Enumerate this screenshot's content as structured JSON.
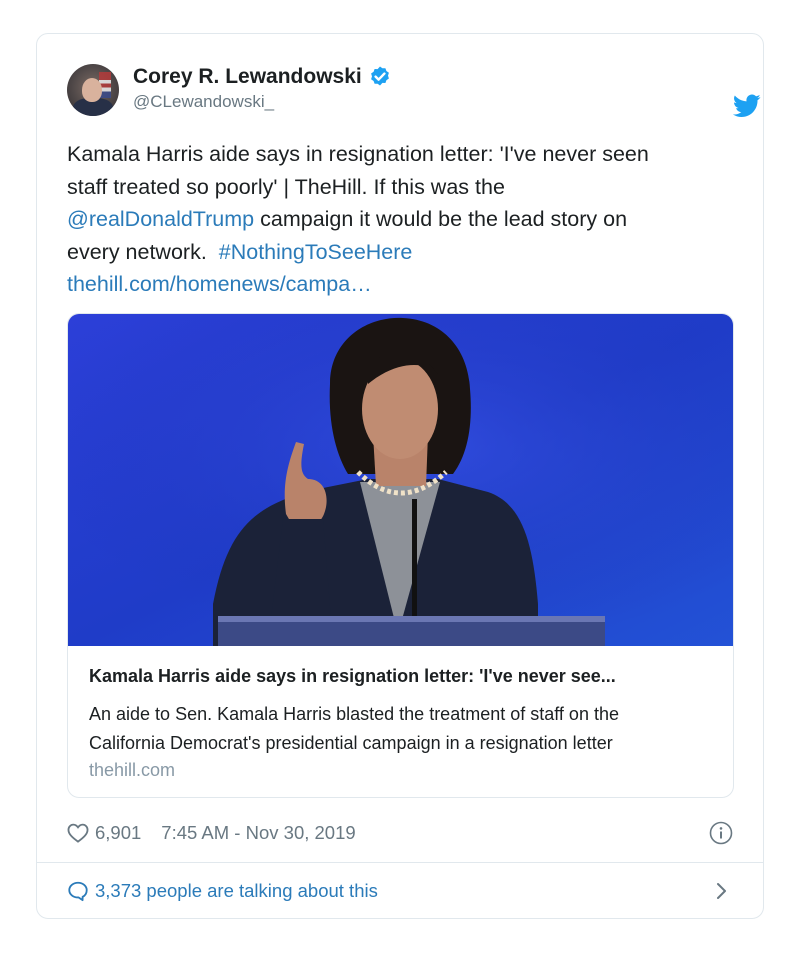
{
  "author": {
    "name": "Corey R. Lewandowski",
    "handle": "@CLewandowski_"
  },
  "tweet": {
    "text_line1": "Kamala Harris aide says in resignation letter: 'I've never seen",
    "text_line2": "staff treated so poorly' | TheHill. If this was the",
    "mention": "@realDonaldTrump",
    "text_line3_rest": " campaign it would be the lead story on",
    "text_line4": "every network.  ",
    "hashtag": "#NothingToSeeHere",
    "url": "thehill.com/homenews/campa…"
  },
  "link_card": {
    "title": "Kamala Harris aide says in resignation letter: 'I've never see...",
    "description_line1": "An aide to Sen. Kamala Harris blasted the treatment of staff on the",
    "description_line2": "California Democrat's presidential campaign in a resignation letter",
    "domain": "thehill.com"
  },
  "footer": {
    "likes": "6,901",
    "timestamp": "7:45 AM - Nov 30, 2019",
    "talking": "3,373 people are talking about this"
  },
  "icons": {
    "verified": "verified-badge-icon",
    "bird": "twitter-bird-icon",
    "heart": "heart-icon",
    "info": "info-icon",
    "bubble": "comment-bubble-icon",
    "chevron": "chevron-right-icon"
  },
  "colors": {
    "link": "#2b7bb9",
    "verified": "#1da1f2",
    "muted": "#697882",
    "border": "#e1e8ed"
  }
}
